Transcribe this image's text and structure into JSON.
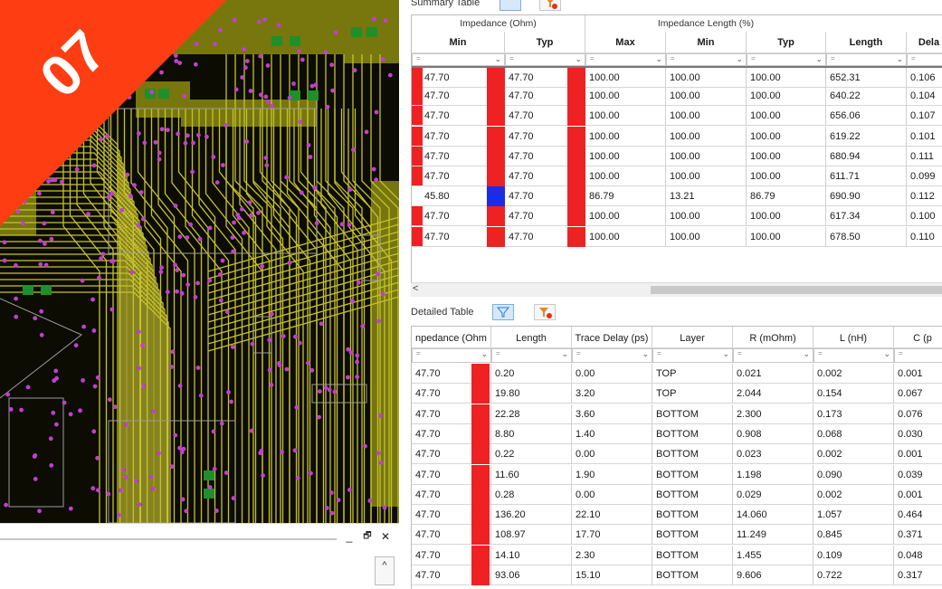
{
  "badge": {
    "number": "07",
    "color": "#ff3d12"
  },
  "colors": {
    "accent_red": "#ee2222",
    "accent_blue": "#1c2be6",
    "pcb_bg": "#0c0c02",
    "trace": "#c7c22f",
    "via": "#c040d0"
  },
  "dock": {
    "minimize": "_",
    "restore": "🗗",
    "close": "✕",
    "scroll_up": "^"
  },
  "summary": {
    "title": "Summary Table",
    "group_impedance": "Impedance (Ohm)",
    "group_length": "Impedance Length (%)",
    "columns": [
      "Min",
      "Typ",
      "Max",
      "Min",
      "Typ",
      "Length",
      "Dela"
    ],
    "filter_placeholder": "=",
    "rows": [
      {
        "imp_min": "47.70",
        "min_color": "red",
        "imp_typ": "47.70",
        "typ_color": "red",
        "max": "100.00",
        "len_min": "100.00",
        "len_typ": "100.00",
        "length": "652.31",
        "delay": "0.106"
      },
      {
        "imp_min": "47.70",
        "min_color": "red",
        "imp_typ": "47.70",
        "typ_color": "red",
        "max": "100.00",
        "len_min": "100.00",
        "len_typ": "100.00",
        "length": "640.22",
        "delay": "0.104"
      },
      {
        "imp_min": "47.70",
        "min_color": "red",
        "imp_typ": "47.70",
        "typ_color": "red",
        "max": "100.00",
        "len_min": "100.00",
        "len_typ": "100.00",
        "length": "656.06",
        "delay": "0.107"
      },
      {
        "imp_min": "47.70",
        "min_color": "red",
        "imp_typ": "47.70",
        "typ_color": "red",
        "max": "100.00",
        "len_min": "100.00",
        "len_typ": "100.00",
        "length": "619.22",
        "delay": "0.101"
      },
      {
        "imp_min": "47.70",
        "min_color": "red",
        "imp_typ": "47.70",
        "typ_color": "red",
        "max": "100.00",
        "len_min": "100.00",
        "len_typ": "100.00",
        "length": "680.94",
        "delay": "0.111"
      },
      {
        "imp_min": "47.70",
        "min_color": "red",
        "imp_typ": "47.70",
        "typ_color": "red",
        "max": "100.00",
        "len_min": "100.00",
        "len_typ": "100.00",
        "length": "611.71",
        "delay": "0.099"
      },
      {
        "imp_min": "45.80",
        "min_color": "none",
        "imp_typ": "47.70",
        "typ_color": "blue",
        "max": "86.79",
        "len_min": "13.21",
        "len_typ": "86.79",
        "length": "690.90",
        "delay": "0.112"
      },
      {
        "imp_min": "47.70",
        "min_color": "red",
        "imp_typ": "47.70",
        "typ_color": "red",
        "max": "100.00",
        "len_min": "100.00",
        "len_typ": "100.00",
        "length": "617.34",
        "delay": "0.100"
      },
      {
        "imp_min": "47.70",
        "min_color": "red",
        "imp_typ": "47.70",
        "typ_color": "red",
        "max": "100.00",
        "len_min": "100.00",
        "len_typ": "100.00",
        "length": "678.50",
        "delay": "0.110"
      }
    ],
    "scroll_left": "<"
  },
  "detailed": {
    "title": "Detailed Table",
    "columns": [
      "npedance (Ohm",
      "Length",
      "Trace Delay (ps)",
      "Layer",
      "R (mOhm)",
      "L (nH)",
      "C (p"
    ],
    "filter_placeholder": "=",
    "rows": [
      {
        "imp": "47.70",
        "length": "0.20",
        "delay": "0.00",
        "layer": "TOP",
        "r": "0.021",
        "l": "0.002",
        "c": "0.001"
      },
      {
        "imp": "47.70",
        "length": "19.80",
        "delay": "3.20",
        "layer": "TOP",
        "r": "2.044",
        "l": "0.154",
        "c": "0.067"
      },
      {
        "imp": "47.70",
        "length": "22.28",
        "delay": "3.60",
        "layer": "BOTTOM",
        "r": "2.300",
        "l": "0.173",
        "c": "0.076"
      },
      {
        "imp": "47.70",
        "length": "8.80",
        "delay": "1.40",
        "layer": "BOTTOM",
        "r": "0.908",
        "l": "0.068",
        "c": "0.030"
      },
      {
        "imp": "47.70",
        "length": "0.22",
        "delay": "0.00",
        "layer": "BOTTOM",
        "r": "0.023",
        "l": "0.002",
        "c": "0.001"
      },
      {
        "imp": "47.70",
        "length": "11.60",
        "delay": "1.90",
        "layer": "BOTTOM",
        "r": "1.198",
        "l": "0.090",
        "c": "0.039"
      },
      {
        "imp": "47.70",
        "length": "0.28",
        "delay": "0.00",
        "layer": "BOTTOM",
        "r": "0.029",
        "l": "0.002",
        "c": "0.001"
      },
      {
        "imp": "47.70",
        "length": "136.20",
        "delay": "22.10",
        "layer": "BOTTOM",
        "r": "14.060",
        "l": "1.057",
        "c": "0.464"
      },
      {
        "imp": "47.70",
        "length": "108.97",
        "delay": "17.70",
        "layer": "BOTTOM",
        "r": "11.249",
        "l": "0.845",
        "c": "0.371"
      },
      {
        "imp": "47.70",
        "length": "14.10",
        "delay": "2.30",
        "layer": "BOTTOM",
        "r": "1.455",
        "l": "0.109",
        "c": "0.048"
      },
      {
        "imp": "47.70",
        "length": "93.06",
        "delay": "15.10",
        "layer": "BOTTOM",
        "r": "9.606",
        "l": "0.722",
        "c": "0.317"
      }
    ]
  }
}
